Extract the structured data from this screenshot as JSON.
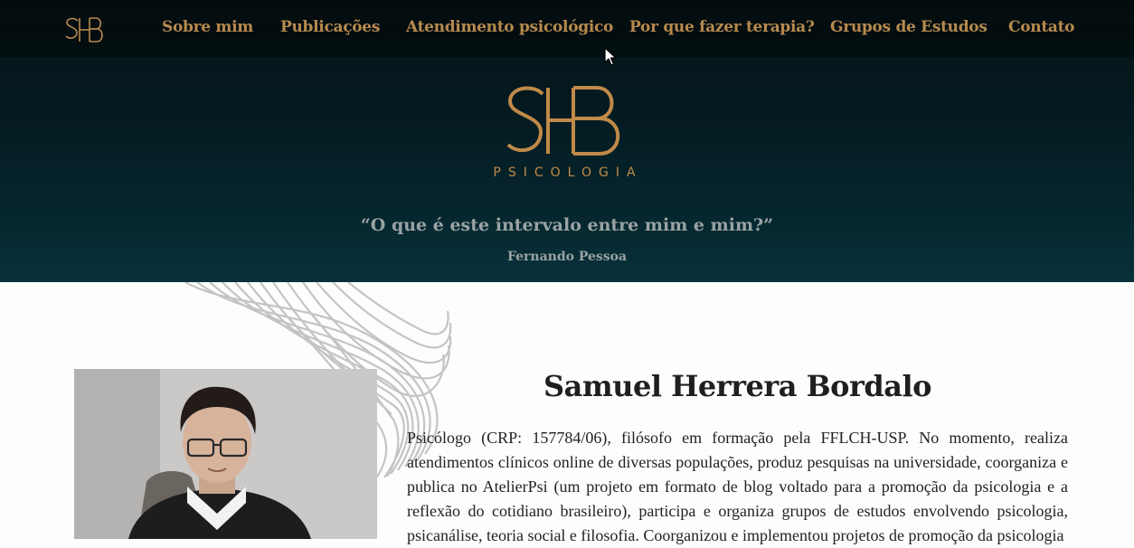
{
  "nav": {
    "logo_alt": "SHB",
    "items": [
      {
        "label": "Sobre mim"
      },
      {
        "label": "Publicações"
      },
      {
        "label": "Atendimento psicológico"
      },
      {
        "label": "Por que fazer terapia?"
      },
      {
        "label": "Grupos de Estudos"
      },
      {
        "label": "Contato"
      }
    ]
  },
  "hero": {
    "logo_subtitle": "PSICOLOGIA",
    "quote": "“O que é este intervalo entre mim e mim?”",
    "quote_author": "Fernando Pessoa"
  },
  "profile": {
    "name": "Samuel Herrera Bordalo",
    "bio": "Psicólogo (CRP: 157784/06), filósofo em formação pela FFLCH-USP. No momento, realiza atendimentos clínicos online de diversas populações, produz pesquisas na universidade, coorganiza e publica no AtelierPsi (um projeto em formato de blog voltado para a promoção da psicologia e a reflexão do cotidiano brasileiro), participa e organiza grupos de estudos envolvendo psicologia, psicanálise, teoria social e filosofia. Coorganizou e implementou projetos de promoção da psicologia"
  },
  "colors": {
    "gold": "#b78a4e",
    "hero_top": "#071317",
    "hero_bottom": "#08313b",
    "quote": "#9aa3a3"
  }
}
